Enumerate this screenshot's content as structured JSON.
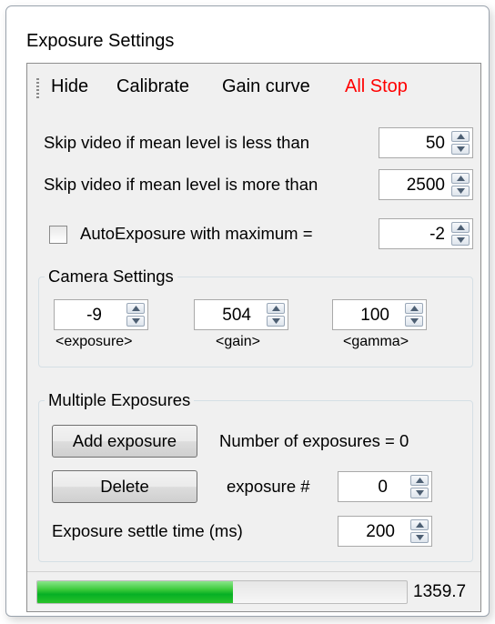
{
  "window": {
    "title": "Exposure Settings"
  },
  "menu": {
    "hide": "Hide",
    "calibrate": "Calibrate",
    "gain_curve": "Gain curve",
    "all_stop": "All Stop",
    "all_stop_color": "#ff0000"
  },
  "skip_low": {
    "label": "Skip video if mean level is less than",
    "value": "50"
  },
  "skip_high": {
    "label": "Skip video if mean level is more than",
    "value": "2500"
  },
  "auto_exposure": {
    "label": "AutoExposure with maximum =",
    "value": "-2",
    "checked": false
  },
  "camera_settings": {
    "title": "Camera Settings",
    "exposure": {
      "value": "-9",
      "label": "<exposure>"
    },
    "gain": {
      "value": "504",
      "label": "<gain>"
    },
    "gamma": {
      "value": "100",
      "label": "<gamma>"
    }
  },
  "multiple_exposures": {
    "title": "Multiple Exposures",
    "add_button": "Add exposure",
    "count_label": "Number of exposures = 0",
    "delete_button": "Delete",
    "exposure_num_label": "exposure #",
    "exposure_num_value": "0",
    "settle_label": "Exposure settle time (ms)",
    "settle_value": "200"
  },
  "status": {
    "progress_fraction": 0.53,
    "value": "1359.7"
  }
}
